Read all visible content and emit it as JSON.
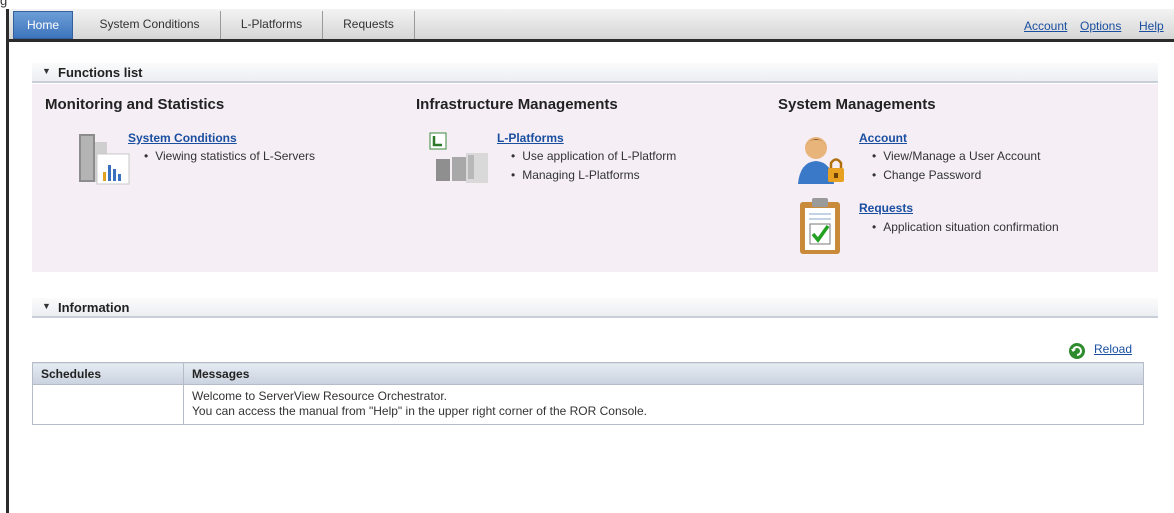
{
  "tabs": [
    {
      "label": "Home",
      "active": true
    },
    {
      "label": "System Conditions",
      "active": false
    },
    {
      "label": "L-Platforms",
      "active": false
    },
    {
      "label": "Requests",
      "active": false
    }
  ],
  "top_links": {
    "account": "Account",
    "options": "Options",
    "help": "Help"
  },
  "functions_list": {
    "header": "Functions list",
    "columns": [
      {
        "title": "Monitoring and Statistics",
        "items": [
          {
            "icon": "server-chart-icon",
            "link": "System Conditions",
            "bullets": [
              "Viewing statistics of L-Servers"
            ]
          }
        ]
      },
      {
        "title": "Infrastructure Managements",
        "items": [
          {
            "icon": "l-platform-icon",
            "link": "L-Platforms",
            "bullets": [
              "Use application of L-Platform",
              "Managing L-Platforms"
            ]
          }
        ]
      },
      {
        "title": "System Managements",
        "items": [
          {
            "icon": "user-lock-icon",
            "link": "Account",
            "bullets": [
              "View/Manage a User Account",
              "Change Password"
            ]
          },
          {
            "icon": "clipboard-check-icon",
            "link": "Requests",
            "bullets": [
              "Application situation confirmation"
            ]
          }
        ]
      }
    ]
  },
  "information": {
    "header": "Information",
    "reload": "Reload",
    "table": {
      "columns": [
        "Schedules",
        "Messages"
      ],
      "rows": [
        {
          "schedule": "",
          "messages": [
            "Welcome to ServerView Resource Orchestrator.",
            "You can access the manual from \"Help\" in the upper right corner of the ROR Console."
          ]
        }
      ]
    }
  },
  "colors": {
    "active_tab": "#4a80c6",
    "link": "#1a4fa0",
    "panel_bg": "#f5eef5",
    "dark_bar": "#2b2b2b"
  }
}
